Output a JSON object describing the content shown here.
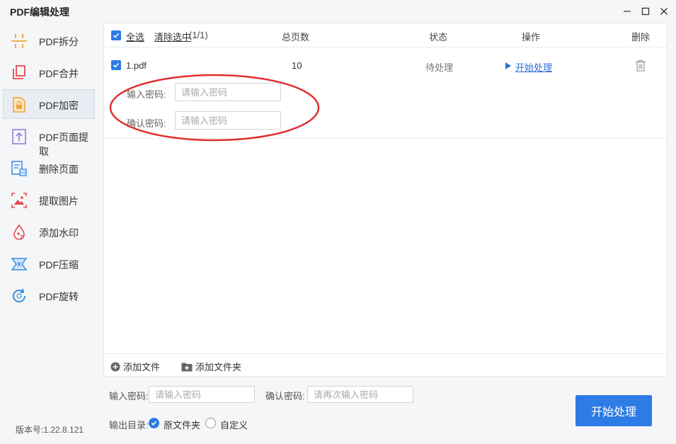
{
  "app": {
    "title": "PDF编辑处理"
  },
  "sidebar": {
    "items": [
      {
        "label": "PDF拆分",
        "icon": "split-icon"
      },
      {
        "label": "PDF合并",
        "icon": "merge-icon"
      },
      {
        "label": "PDF加密",
        "icon": "lock-file-icon",
        "active": true
      },
      {
        "label": "PDF页面提取",
        "icon": "page-extract-icon"
      },
      {
        "label": "删除页面",
        "icon": "delete-page-icon"
      },
      {
        "label": "提取图片",
        "icon": "image-extract-icon"
      },
      {
        "label": "添加水印",
        "icon": "watermark-icon"
      },
      {
        "label": "PDF压缩",
        "icon": "compress-icon"
      },
      {
        "label": "PDF旋转",
        "icon": "rotate-icon"
      }
    ],
    "version": "版本号:1.22.8.121"
  },
  "table": {
    "select_all": "全选",
    "clear_selection": "清除选中",
    "selection_count": "(1/1)",
    "headers": {
      "pages": "总页数",
      "status": "状态",
      "action": "操作",
      "delete": "删除"
    },
    "rows": [
      {
        "name": "1.pdf",
        "pages": "10",
        "status": "待处理",
        "action": "开始处理",
        "password_label": "输入密码:",
        "password_placeholder": "请输入密码",
        "confirm_label": "确认密码:",
        "confirm_placeholder": "请输入密码"
      }
    ]
  },
  "footer": {
    "add_file": "添加文件",
    "add_folder": "添加文件夹"
  },
  "bottom": {
    "password_label": "输入密码:",
    "password_placeholder": "请输入密码",
    "confirm_label": "确认密码:",
    "confirm_placeholder": "请再次输入密码",
    "output_label": "输出目录:",
    "option_original": "原文件夹",
    "option_custom": "自定义",
    "start_button": "开始处理"
  },
  "colors": {
    "accent": "#2d7be5",
    "annotation": "#e0302f"
  }
}
